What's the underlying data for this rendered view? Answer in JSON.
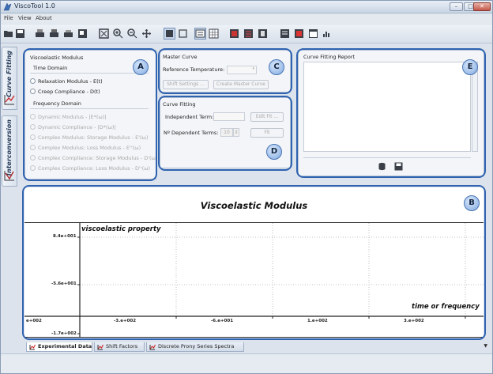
{
  "window": {
    "title": "ViscoTool 1.0",
    "min": "–",
    "max": "□",
    "close": "✕"
  },
  "menu": [
    "File",
    "View",
    "About"
  ],
  "side_tabs": [
    "Curve Fitting",
    "Interconversion"
  ],
  "panel_a": {
    "badge": "A",
    "title": "Viscoelastic Modulus",
    "time_domain": "Time Domain",
    "time_options": [
      "Relaxation Modulus - E(t)",
      "Creep Compliance - D(t)"
    ],
    "freq_domain": "Frequency Domain",
    "freq_options": [
      "Dynamic Modulus - |E*(ω)|",
      "Dynamic Compliance - |D*(ω)|",
      "Complex Modulus: Storage Modulus - E'(ω)",
      "Complex Modulus: Loss Modulus - E''(ω)",
      "Complex Compliance: Storage Modulus - D'(ω)",
      "Complex Compliance: Loss Modulus - D''(ω)"
    ]
  },
  "panel_c": {
    "badge": "C",
    "title": "Master Curve",
    "ref_temp_label": "Reference Temperature:",
    "shift_button": "Shift Settings ...",
    "create_button": "Create Master Curve"
  },
  "panel_d": {
    "badge": "D",
    "title": "Curve Fitting",
    "independent_label": "Independent Term:",
    "edit_fit_button": "Edit Fit ...",
    "dependent_label": "Nº Dependent Terms:",
    "dependent_value": "10",
    "fit_button": "Fit"
  },
  "panel_e": {
    "badge": "E",
    "title": "Curve Fitting Report"
  },
  "chart_badge": "B",
  "chart_data": {
    "type": "line",
    "title": "Viscoelastic Modulus",
    "ylabel": "viscoelastic property",
    "xlabel": "time or frequency",
    "x_ticks": [
      "e+002",
      "-3.e+002",
      "-6.e+001",
      "1.e+002",
      "3.e+002"
    ],
    "y_ticks": [
      "8.4e+001",
      "-5.6e+001",
      "-1.7e+002"
    ],
    "grid": true,
    "series": []
  },
  "bottom_tabs": [
    "Experimental Data",
    "Shift Factors",
    "Discrete Prony Series Spectra"
  ],
  "colors": {
    "highlight": "#2f63b0",
    "accent": "#6f9bd6"
  }
}
